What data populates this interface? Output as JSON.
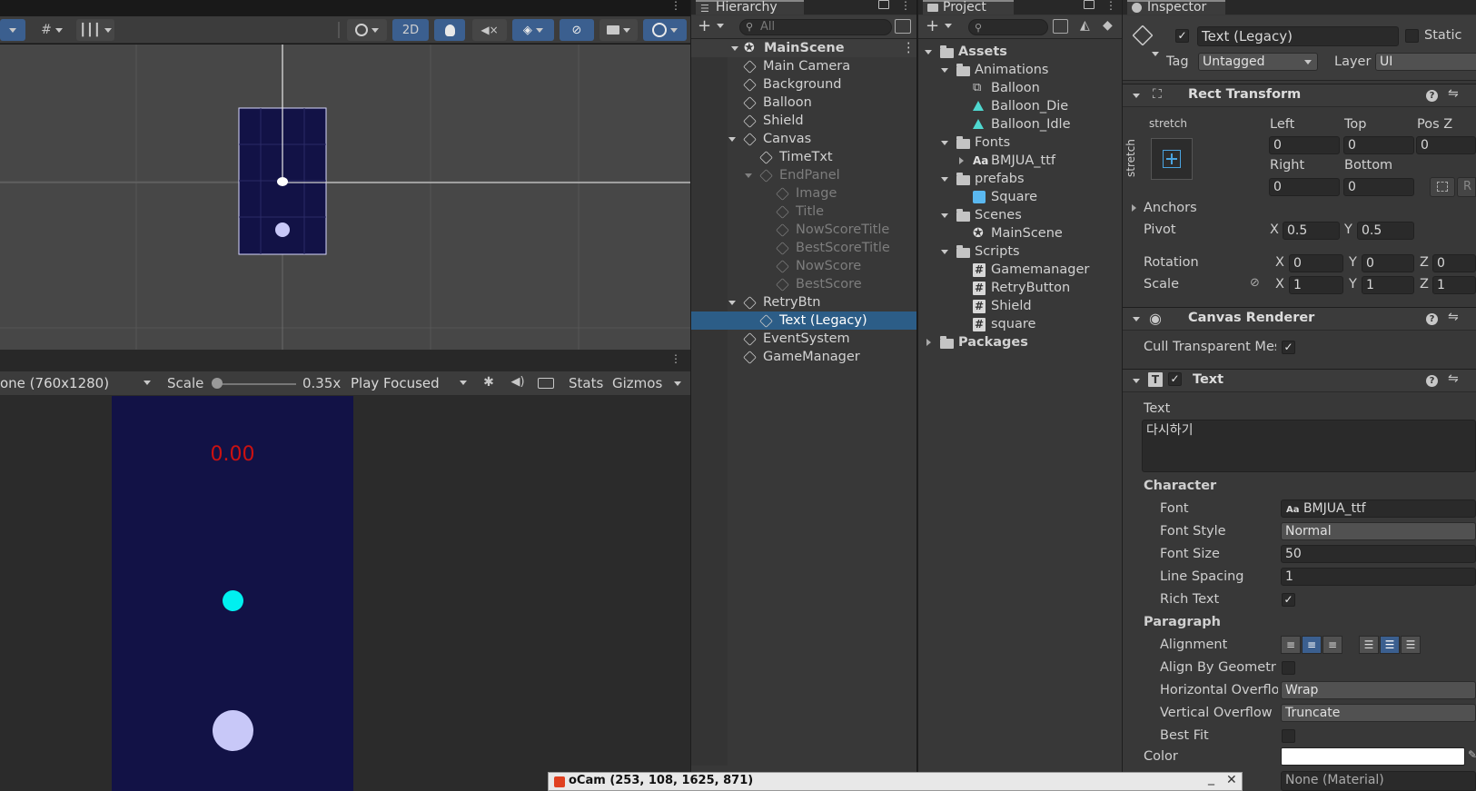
{
  "scene_toolbar": {
    "mode_2d": "2D"
  },
  "game_toolbar": {
    "resolution": "one (760x1280)",
    "scale_label": "Scale",
    "scale_value": "0.35x",
    "play_mode": "Play Focused",
    "stats": "Stats",
    "gizmos": "Gizmos"
  },
  "game_view": {
    "timer": "0.00"
  },
  "hierarchy": {
    "tab": "Hierarchy",
    "search_placeholder": "All",
    "scene_name": "MainScene",
    "items": [
      {
        "label": "Main Camera",
        "depth": 1,
        "dim": false
      },
      {
        "label": "Background",
        "depth": 1,
        "dim": false
      },
      {
        "label": "Balloon",
        "depth": 1,
        "dim": false
      },
      {
        "label": "Shield",
        "depth": 1,
        "dim": false
      },
      {
        "label": "Canvas",
        "depth": 1,
        "dim": false,
        "expanded": true
      },
      {
        "label": "TimeTxt",
        "depth": 2,
        "dim": false
      },
      {
        "label": "EndPanel",
        "depth": 2,
        "dim": true,
        "expanded": true
      },
      {
        "label": "Image",
        "depth": 3,
        "dim": true
      },
      {
        "label": "Title",
        "depth": 3,
        "dim": true
      },
      {
        "label": "NowScoreTitle",
        "depth": 3,
        "dim": true
      },
      {
        "label": "BestScoreTitle",
        "depth": 3,
        "dim": true
      },
      {
        "label": "NowScore",
        "depth": 3,
        "dim": true
      },
      {
        "label": "BestScore",
        "depth": 3,
        "dim": true
      },
      {
        "label": "RetryBtn",
        "depth": 1,
        "dim": false,
        "expanded": true
      },
      {
        "label": "Text (Legacy)",
        "depth": 2,
        "dim": false,
        "selected": true
      },
      {
        "label": "EventSystem",
        "depth": 1,
        "dim": false
      },
      {
        "label": "GameManager",
        "depth": 1,
        "dim": false
      }
    ]
  },
  "project": {
    "tab": "Project",
    "items": [
      {
        "label": "Assets",
        "depth": 0,
        "kind": "folder",
        "expanded": true
      },
      {
        "label": "Animations",
        "depth": 1,
        "kind": "folder",
        "expanded": true
      },
      {
        "label": "Balloon",
        "depth": 2,
        "kind": "animator"
      },
      {
        "label": "Balloon_Die",
        "depth": 2,
        "kind": "anim"
      },
      {
        "label": "Balloon_Idle",
        "depth": 2,
        "kind": "anim"
      },
      {
        "label": "Fonts",
        "depth": 1,
        "kind": "folder",
        "expanded": true
      },
      {
        "label": "BMJUA_ttf",
        "depth": 2,
        "kind": "font",
        "collapsed": true
      },
      {
        "label": "prefabs",
        "depth": 1,
        "kind": "folder",
        "expanded": true
      },
      {
        "label": "Square",
        "depth": 2,
        "kind": "prefab"
      },
      {
        "label": "Scenes",
        "depth": 1,
        "kind": "folder",
        "expanded": true
      },
      {
        "label": "MainScene",
        "depth": 2,
        "kind": "scene"
      },
      {
        "label": "Scripts",
        "depth": 1,
        "kind": "folder",
        "expanded": true
      },
      {
        "label": "Gamemanager",
        "depth": 2,
        "kind": "script"
      },
      {
        "label": "RetryButton",
        "depth": 2,
        "kind": "script"
      },
      {
        "label": "Shield",
        "depth": 2,
        "kind": "script"
      },
      {
        "label": "square",
        "depth": 2,
        "kind": "script"
      },
      {
        "label": "Packages",
        "depth": 0,
        "kind": "folder",
        "collapsed": true
      }
    ]
  },
  "inspector": {
    "tab": "Inspector",
    "object_name": "Text (Legacy)",
    "static_label": "Static",
    "tag_label": "Tag",
    "tag_value": "Untagged",
    "layer_label": "Layer",
    "layer_value": "UI",
    "rect": {
      "title": "Rect Transform",
      "stretch": "stretch",
      "stretch_v": "stretch",
      "left_label": "Left",
      "left": "0",
      "top_label": "Top",
      "top": "0",
      "posz_label": "Pos Z",
      "posz": "0",
      "right_label": "Right",
      "right": "0",
      "bottom_label": "Bottom",
      "bottom": "0",
      "r_btn": "R",
      "anchors": "Anchors",
      "pivot": "Pivot",
      "pivot_x": "0.5",
      "pivot_y": "0.5",
      "rotation": "Rotation",
      "rot_x": "0",
      "rot_y": "0",
      "rot_z": "0",
      "scale": "Scale",
      "scale_x": "1",
      "scale_y": "1",
      "scale_z": "1",
      "x": "X",
      "y": "Y",
      "z": "Z"
    },
    "canvas_renderer": {
      "title": "Canvas Renderer",
      "cull": "Cull Transparent Mes"
    },
    "text": {
      "title": "Text",
      "text_label": "Text",
      "text_value": "다시하기",
      "character": "Character",
      "font_label": "Font",
      "font_value": "BMJUA_ttf",
      "aa": "Aa",
      "style_label": "Font Style",
      "style_value": "Normal",
      "size_label": "Font Size",
      "size_value": "50",
      "spacing_label": "Line Spacing",
      "spacing_value": "1",
      "rich_label": "Rich Text",
      "paragraph": "Paragraph",
      "alignment_label": "Alignment",
      "geometry_label": "Align By Geometry",
      "hover_label": "Horizontal Overflo",
      "hover_value": "Wrap",
      "vover_label": "Vertical Overflow",
      "vover_value": "Truncate",
      "bestfit_label": "Best Fit",
      "color_label": "Color",
      "color_value": "#ffffff",
      "material_value": "None (Material)"
    }
  },
  "ocam": {
    "title": "oCam (253, 108, 1625, 871)"
  },
  "colors": {
    "scene_bg": "#474747",
    "game_bg": "#121246",
    "selection": "#2c5d87",
    "accent": "#3b5f8f",
    "timer": "#cc1111",
    "player": "#00f0f0",
    "balloon": "#c8c8f8"
  }
}
